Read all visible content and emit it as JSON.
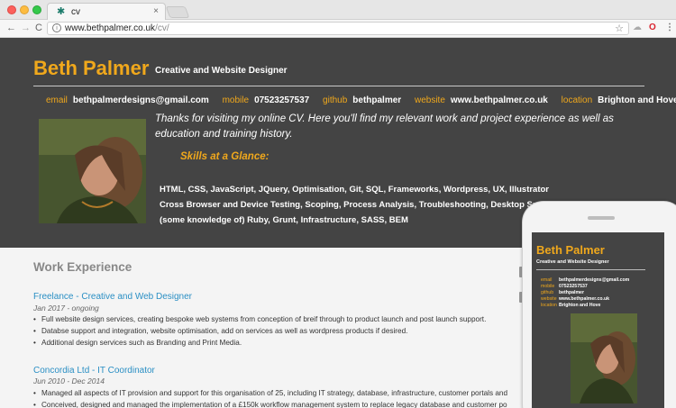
{
  "browser": {
    "tab_title": "cv",
    "tab_close": "×",
    "favicon": "✱",
    "url_host": "www.bethpalmer.co.uk",
    "url_path": "/cv/",
    "nav_back": "←",
    "nav_forward": "→",
    "nav_reload": "C",
    "star": "☆",
    "ext_cloud": "☁",
    "ext_opera": "O",
    "menu": "⋮"
  },
  "header": {
    "name": "Beth Palmer",
    "role": "Creative and Website Designer"
  },
  "contacts": [
    {
      "key": "email",
      "value": "bethpalmerdesigns@gmail.com"
    },
    {
      "key": "mobile",
      "value": "07523257537"
    },
    {
      "key": "github",
      "value": "bethpalmer"
    },
    {
      "key": "website",
      "value": "www.bethpalmer.co.uk"
    },
    {
      "key": "location",
      "value": "Brighton and Hove"
    }
  ],
  "intro": "Thanks for visiting my online CV. Here you'll find my relevant work and project experience as well as education and training history.",
  "skills": {
    "heading": "Skills at a Glance:",
    "lines": [
      "HTML, CSS, JavaScript, JQuery, Optimisation, Git, SQL, Frameworks, Wordpress, UX, Illustrator",
      "Cross Browser and Device Testing, Scoping, Process Analysis, Troubleshooting, Desktop Suppo",
      "(some knowledge of) Ruby, Grunt, Infrastructure, SASS, BEM"
    ]
  },
  "work": {
    "heading": "Work Experience",
    "jobs": [
      {
        "title": "Freelance - Creative and Web Designer",
        "dates": "Jan 2017 - ongoing",
        "bullets": [
          "Full website design services, creating bespoke web systems from conception of breif through to product launch and post launch support.",
          "Databse support and integration, website optimisation, add on services as well as wordpress products if desired.",
          "Additional design services such as Branding and Print Media."
        ]
      },
      {
        "title": "Concordia Ltd - IT Coordinator",
        "dates": "Jun 2010 - Dec 2014",
        "bullets": [
          "Managed all aspects of IT provision and support for this organisation of 25, including IT strategy, database, infrastructure, customer portals and",
          "Conceived, designed and managed the implementation of a £150k workflow management system to replace legacy database and customer po"
        ]
      }
    ]
  },
  "phone": {
    "name": "Beth Palmer",
    "role": "Creative and Website Designer",
    "contacts": [
      {
        "key": "email",
        "value": "bethpalmerdesigns@gmail.com"
      },
      {
        "key": "mobile",
        "value": "07523257537"
      },
      {
        "key": "github",
        "value": "bethpalmer"
      },
      {
        "key": "website",
        "value": "www.bethpalmer.co.uk"
      },
      {
        "key": "location",
        "value": "Brighton and Hove"
      }
    ]
  },
  "colors": {
    "accent": "#f0a81c",
    "hero_bg": "#444444",
    "link": "#2a8fc4"
  }
}
